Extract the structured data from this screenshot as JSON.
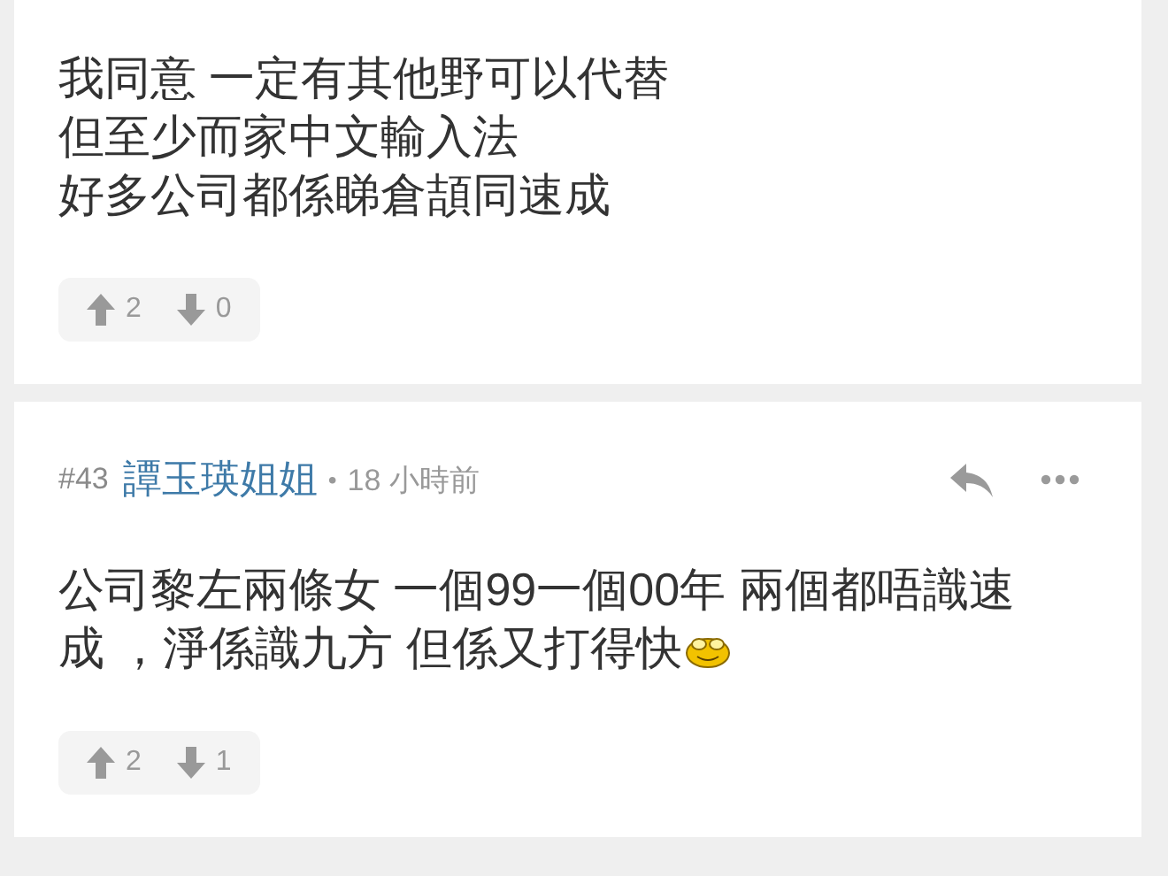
{
  "comments": [
    {
      "body_lines": [
        "我同意 一定有其他野可以代替",
        "但至少而家中文輸入法",
        "好多公司都係睇倉頡同速成"
      ],
      "upvotes": "2",
      "downvotes": "0"
    },
    {
      "number": "#43",
      "author": "譚玉瑛姐姐",
      "separator": "•",
      "time": "18 小時前",
      "body_lines": [
        "公司黎左兩條女 一個99一個00年 兩個都唔識速",
        "成 ，淨係識九方 但係又打得快"
      ],
      "emoticon": true,
      "upvotes": "2",
      "downvotes": "1"
    }
  ]
}
